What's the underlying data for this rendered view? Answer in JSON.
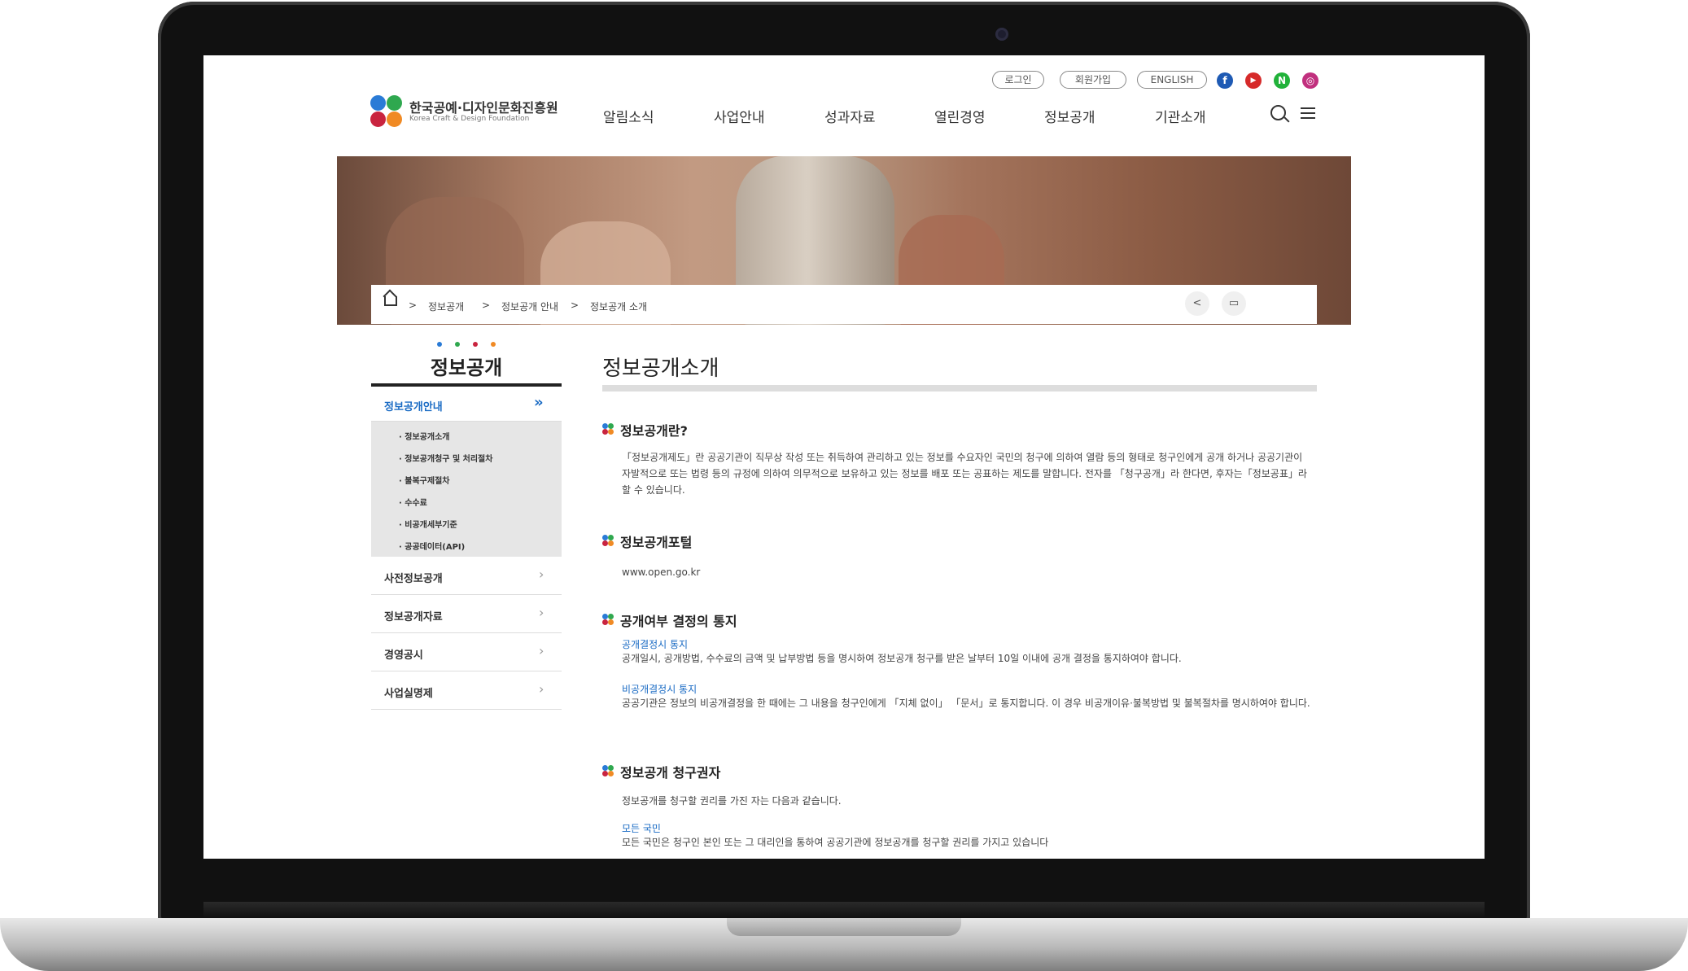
{
  "header": {
    "login": "로그인",
    "join": "회원가입",
    "english": "ENGLISH",
    "sns": [
      "f",
      "▶",
      "N",
      "◎"
    ],
    "logo_ko": "한국공예·디자인문화진흥원",
    "logo_en": "Korea Craft & Design Foundation",
    "gnb": [
      "알림소식",
      "사업안내",
      "성과자료",
      "열린경영",
      "정보공개",
      "기관소개"
    ]
  },
  "breadcrumb": [
    "정보공개",
    "정보공개 안내",
    "정보공개 소개"
  ],
  "breadcrumb_sep": ">",
  "lnb": {
    "title": "정보공개",
    "active": "정보공개안내",
    "sub": [
      "· 정보공개소개",
      "· 정보공개청구 및 처리절차",
      "· 불복구제절차",
      "· 수수료",
      "· 비공개세부기준",
      "· 공공데이터(API)"
    ],
    "items": [
      "사전정보공개",
      "정보공개자료",
      "경영공시",
      "사업실명제"
    ]
  },
  "content": {
    "title": "정보공개소개",
    "sections": [
      {
        "heading": "정보공개란?",
        "text": "「정보공개제도」란 공공기관이 직무상 작성 또는 취득하여 관리하고 있는 정보를 수요자인 국민의 청구에 의하여 열람 등의 형태로 청구인에게 공개 하거나 공공기관이 자발적으로 또는 법령 등의 규정에 의하여 의무적으로 보유하고 있는 정보를 배포 또는 공표하는 제도를 말합니다. 전자를 「청구공개」라 한다면, 후자는「정보공표」라 할 수 있습니다."
      },
      {
        "heading": "정보공개포털",
        "text": "www.open.go.kr"
      },
      {
        "heading": "공개여부 결정의 통지",
        "sub1": "공개결정시 통지",
        "text1": "공개일시, 공개방법, 수수료의 금액 및 납부방법 등을 명시하여 정보공개 청구를 받은 날부터 10일 이내에 공개 결정을 통지하여야 합니다.",
        "sub2": "비공개결정시 통지",
        "text2": "공공기관은 정보의 비공개결정을 한 때에는 그 내용을 청구인에게 「지체 없이」 「문서」로 통지합니다. 이 경우 비공개이유·불복방법 및 불복절차를 명시하여야 합니다."
      },
      {
        "heading": "정보공개 청구권자",
        "text": "정보공개를 청구할 권리를 가진 자는 다음과 같습니다.",
        "sub1": "모든 국민",
        "text1": "모든 국민은 청구인 본인 또는 그 대리인을 통하여 공공기관에 정보공개를 청구할 권리를 가지고 있습니다"
      }
    ]
  },
  "colors": {
    "accent": "#1a6bc4",
    "logo": [
      "#2a7bd6",
      "#2fa84f",
      "#c9243f",
      "#f08a24"
    ]
  }
}
